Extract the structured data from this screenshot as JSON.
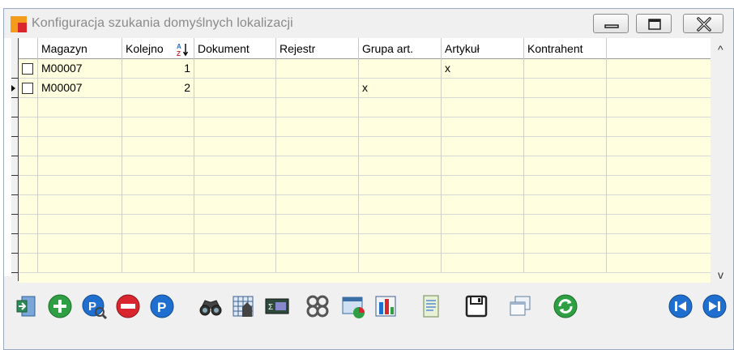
{
  "window": {
    "title": "Konfiguracja szukania domyślnych lokalizacji",
    "controls": [
      "minimize-icon",
      "maximize-icon",
      "close-icon"
    ]
  },
  "table": {
    "columns": [
      "Magazyn",
      "Kolejność",
      "Dokument",
      "Rejestr",
      "Grupa art.",
      "Artykuł",
      "Kontrahent"
    ],
    "header": {
      "magazyn": "Magazyn",
      "kolejnosc": "Kolejno",
      "dokument": "Dokument",
      "rejestr": "Rejestr",
      "grupa": "Grupa art.",
      "artykul": "Artykuł",
      "kontrahent": "Kontrahent"
    },
    "rows": [
      {
        "magazyn": "M00007",
        "kolejnosc": "1",
        "dokument": "",
        "rejestr": "",
        "grupa": "",
        "artykul": "x",
        "kontrahent": "",
        "checked": false
      },
      {
        "magazyn": "M00007",
        "kolejnosc": "2",
        "dokument": "",
        "rejestr": "",
        "grupa": "x",
        "artykul": "",
        "kontrahent": "",
        "checked": false
      }
    ],
    "current_row": 2,
    "sort_column": "Kolejność"
  },
  "scrollbars": {
    "up": "^",
    "down": "v",
    "left": "<",
    "right": ">"
  },
  "toolbar": {
    "buttons": [
      "exit-icon",
      "add-icon",
      "edit-icon",
      "delete-icon",
      "p-icon",
      "binoculars-icon",
      "filter-table-icon",
      "calculator-icon",
      "settings-gears-icon",
      "report-icon",
      "chart-icon",
      "document-icon",
      "save-icon",
      "windows-icon",
      "refresh-icon",
      "first-record-icon",
      "last-record-icon"
    ]
  },
  "colors": {
    "row_background": "#ffffe0",
    "title_text": "#8a8a8a",
    "accent_green": "#2ea043",
    "accent_blue": "#1f6fd1",
    "accent_red": "#d9262e"
  }
}
